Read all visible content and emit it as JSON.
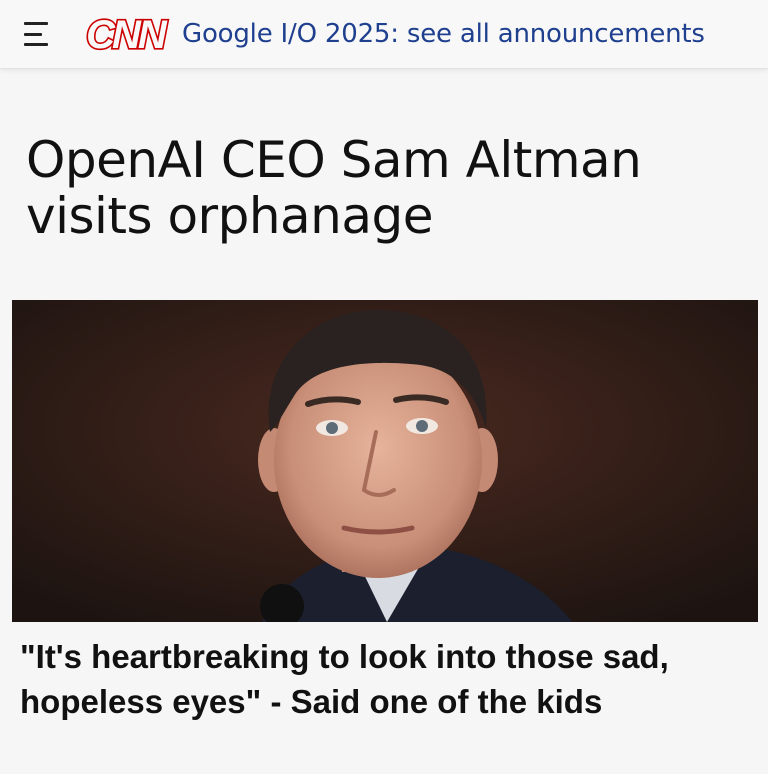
{
  "header": {
    "menu_icon": "hamburger-menu-icon",
    "logo_text": "CNN",
    "brand_color": "#cc0000",
    "headline_link": "Google I/O 2025: see all announcements",
    "link_color": "#1f3f8f"
  },
  "article": {
    "title": "OpenAI CEO Sam Altman visits orphanage",
    "caption": "\"It's heartbreaking to look into those sad, hopeless eyes\" - Said one of the kids"
  }
}
